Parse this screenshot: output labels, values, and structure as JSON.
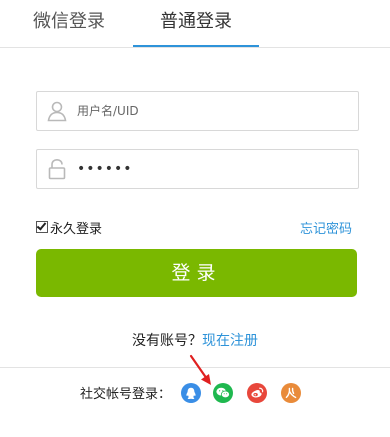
{
  "tabs": [
    {
      "label": "微信登录"
    },
    {
      "label": "普通登录",
      "active": true
    }
  ],
  "form": {
    "username_placeholder": "用户名/UID",
    "password_value": "******",
    "remember_checked": true,
    "remember_label": "永久登录",
    "forgot_label": "忘记密码",
    "login_label": "登录"
  },
  "register": {
    "question": "没有账号？",
    "link": "现在注册"
  },
  "social": {
    "label": "社交帐号登录：",
    "providers": [
      {
        "icon": "qq-icon",
        "color": "#3a8ee6"
      },
      {
        "icon": "wechat-icon",
        "color": "#1fb84f"
      },
      {
        "icon": "weibo-icon",
        "color": "#e8473b"
      },
      {
        "icon": "renren-icon",
        "color": "#e98b3a"
      }
    ]
  },
  "colors": {
    "accent": "#2e93d9",
    "login_button": "#7ab800"
  }
}
